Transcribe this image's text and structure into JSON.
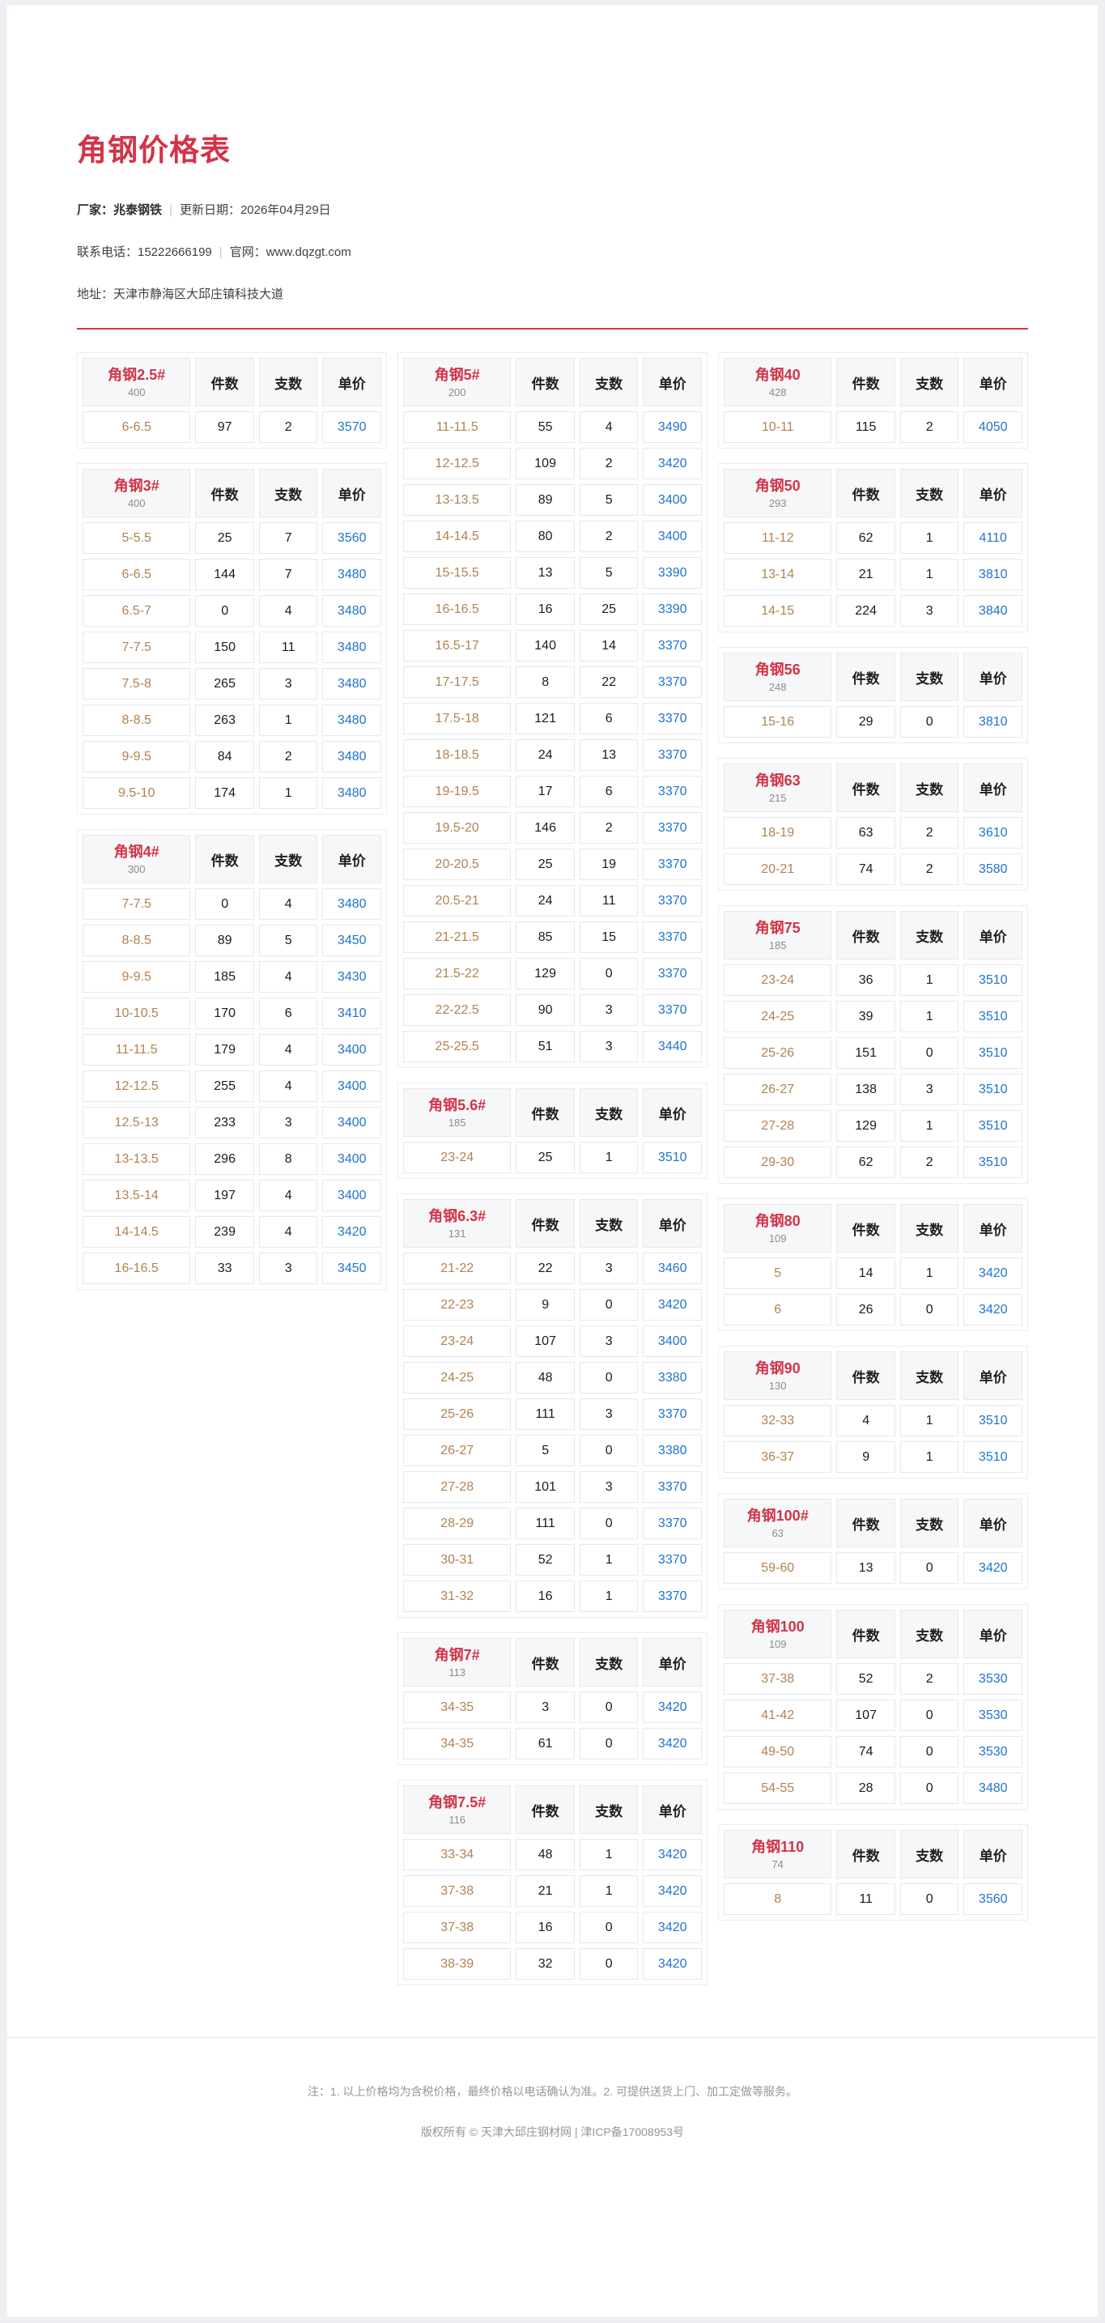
{
  "header": {
    "title": "角钢价格表",
    "vendor_label": "厂家：",
    "vendor": "兆泰钢铁",
    "update": "更新日期：2026年04月29日",
    "phone": "联系电话：15222666199",
    "website": "官网：www.dqzgt.com",
    "address": "地址：天津市静海区大邱庄镇科技大道",
    "sep": "|"
  },
  "colors": {
    "title_red": "#d23449",
    "divider_red": "#cb3a44",
    "price_blue": "#1f74cd",
    "label_tan": "#b08350",
    "header_cell_bg": "#f6f7f8"
  },
  "table_headers": [
    "件数",
    "支数",
    "单价"
  ],
  "columns": [
    [
      {
        "name": "角钢2.5#",
        "sub": "400",
        "rows": [
          [
            "6-6.5",
            "97",
            "2",
            "3570"
          ]
        ]
      },
      {
        "name": "角钢3#",
        "sub": "400",
        "rows": [
          [
            "5-5.5",
            "25",
            "7",
            "3560"
          ],
          [
            "6-6.5",
            "144",
            "7",
            "3480"
          ],
          [
            "6.5-7",
            "0",
            "4",
            "3480"
          ],
          [
            "7-7.5",
            "150",
            "11",
            "3480"
          ],
          [
            "7.5-8",
            "265",
            "3",
            "3480"
          ],
          [
            "8-8.5",
            "263",
            "1",
            "3480"
          ],
          [
            "9-9.5",
            "84",
            "2",
            "3480"
          ],
          [
            "9.5-10",
            "174",
            "1",
            "3480"
          ]
        ]
      },
      {
        "name": "角钢4#",
        "sub": "300",
        "rows": [
          [
            "7-7.5",
            "0",
            "4",
            "3480"
          ],
          [
            "8-8.5",
            "89",
            "5",
            "3450"
          ],
          [
            "9-9.5",
            "185",
            "4",
            "3430"
          ],
          [
            "10-10.5",
            "170",
            "6",
            "3410"
          ],
          [
            "11-11.5",
            "179",
            "4",
            "3400"
          ],
          [
            "12-12.5",
            "255",
            "4",
            "3400"
          ],
          [
            "12.5-13",
            "233",
            "3",
            "3400"
          ],
          [
            "13-13.5",
            "296",
            "8",
            "3400"
          ],
          [
            "13.5-14",
            "197",
            "4",
            "3400"
          ],
          [
            "14-14.5",
            "239",
            "4",
            "3420"
          ],
          [
            "16-16.5",
            "33",
            "3",
            "3450"
          ]
        ]
      }
    ],
    [
      {
        "name": "角钢5#",
        "sub": "200",
        "rows": [
          [
            "11-11.5",
            "55",
            "4",
            "3490"
          ],
          [
            "12-12.5",
            "109",
            "2",
            "3420"
          ],
          [
            "13-13.5",
            "89",
            "5",
            "3400"
          ],
          [
            "14-14.5",
            "80",
            "2",
            "3400"
          ],
          [
            "15-15.5",
            "13",
            "5",
            "3390"
          ],
          [
            "16-16.5",
            "16",
            "25",
            "3390"
          ],
          [
            "16.5-17",
            "140",
            "14",
            "3370"
          ],
          [
            "17-17.5",
            "8",
            "22",
            "3370"
          ],
          [
            "17.5-18",
            "121",
            "6",
            "3370"
          ],
          [
            "18-18.5",
            "24",
            "13",
            "3370"
          ],
          [
            "19-19.5",
            "17",
            "6",
            "3370"
          ],
          [
            "19.5-20",
            "146",
            "2",
            "3370"
          ],
          [
            "20-20.5",
            "25",
            "19",
            "3370"
          ],
          [
            "20.5-21",
            "24",
            "11",
            "3370"
          ],
          [
            "21-21.5",
            "85",
            "15",
            "3370"
          ],
          [
            "21.5-22",
            "129",
            "0",
            "3370"
          ],
          [
            "22-22.5",
            "90",
            "3",
            "3370"
          ],
          [
            "25-25.5",
            "51",
            "3",
            "3440"
          ]
        ]
      },
      {
        "name": "角钢5.6#",
        "sub": "185",
        "rows": [
          [
            "23-24",
            "25",
            "1",
            "3510"
          ]
        ]
      },
      {
        "name": "角钢6.3#",
        "sub": "131",
        "rows": [
          [
            "21-22",
            "22",
            "3",
            "3460"
          ],
          [
            "22-23",
            "9",
            "0",
            "3420"
          ],
          [
            "23-24",
            "107",
            "3",
            "3400"
          ],
          [
            "24-25",
            "48",
            "0",
            "3380"
          ],
          [
            "25-26",
            "111",
            "3",
            "3370"
          ],
          [
            "26-27",
            "5",
            "0",
            "3380"
          ],
          [
            "27-28",
            "101",
            "3",
            "3370"
          ],
          [
            "28-29",
            "111",
            "0",
            "3370"
          ],
          [
            "30-31",
            "52",
            "1",
            "3370"
          ],
          [
            "31-32",
            "16",
            "1",
            "3370"
          ]
        ]
      },
      {
        "name": "角钢7#",
        "sub": "113",
        "rows": [
          [
            "34-35",
            "3",
            "0",
            "3420"
          ],
          [
            "34-35",
            "61",
            "0",
            "3420"
          ]
        ]
      },
      {
        "name": "角钢7.5#",
        "sub": "116",
        "rows": [
          [
            "33-34",
            "48",
            "1",
            "3420"
          ],
          [
            "37-38",
            "21",
            "1",
            "3420"
          ],
          [
            "37-38",
            "16",
            "0",
            "3420"
          ],
          [
            "38-39",
            "32",
            "0",
            "3420"
          ]
        ]
      }
    ],
    [
      {
        "name": "角钢40",
        "sub": "428",
        "rows": [
          [
            "10-11",
            "115",
            "2",
            "4050"
          ]
        ]
      },
      {
        "name": "角钢50",
        "sub": "293",
        "rows": [
          [
            "11-12",
            "62",
            "1",
            "4110"
          ],
          [
            "13-14",
            "21",
            "1",
            "3810"
          ],
          [
            "14-15",
            "224",
            "3",
            "3840"
          ]
        ]
      },
      {
        "name": "角钢56",
        "sub": "248",
        "rows": [
          [
            "15-16",
            "29",
            "0",
            "3810"
          ]
        ]
      },
      {
        "name": "角钢63",
        "sub": "215",
        "rows": [
          [
            "18-19",
            "63",
            "2",
            "3610"
          ],
          [
            "20-21",
            "74",
            "2",
            "3580"
          ]
        ]
      },
      {
        "name": "角钢75",
        "sub": "185",
        "rows": [
          [
            "23-24",
            "36",
            "1",
            "3510"
          ],
          [
            "24-25",
            "39",
            "1",
            "3510"
          ],
          [
            "25-26",
            "151",
            "0",
            "3510"
          ],
          [
            "26-27",
            "138",
            "3",
            "3510"
          ],
          [
            "27-28",
            "129",
            "1",
            "3510"
          ],
          [
            "29-30",
            "62",
            "2",
            "3510"
          ]
        ]
      },
      {
        "name": "角钢80",
        "sub": "109",
        "rows": [
          [
            "5",
            "14",
            "1",
            "3420"
          ],
          [
            "6",
            "26",
            "0",
            "3420"
          ]
        ]
      },
      {
        "name": "角钢90",
        "sub": "130",
        "rows": [
          [
            "32-33",
            "4",
            "1",
            "3510"
          ],
          [
            "36-37",
            "9",
            "1",
            "3510"
          ]
        ]
      },
      {
        "name": "角钢100#",
        "sub": "63",
        "rows": [
          [
            "59-60",
            "13",
            "0",
            "3420"
          ]
        ]
      },
      {
        "name": "角钢100",
        "sub": "109",
        "rows": [
          [
            "37-38",
            "52",
            "2",
            "3530"
          ],
          [
            "41-42",
            "107",
            "0",
            "3530"
          ],
          [
            "49-50",
            "74",
            "0",
            "3530"
          ],
          [
            "54-55",
            "28",
            "0",
            "3480"
          ]
        ]
      },
      {
        "name": "角钢110",
        "sub": "74",
        "rows": [
          [
            "8",
            "11",
            "0",
            "3560"
          ]
        ]
      }
    ]
  ],
  "footer": {
    "note": "注：1. 以上价格均为含税价格，最终价格以电话确认为准。2. 可提供送货上门、加工定做等服务。",
    "copyright": "版权所有 © 天津大邱庄钢材网 | 津ICP备17008953号"
  }
}
